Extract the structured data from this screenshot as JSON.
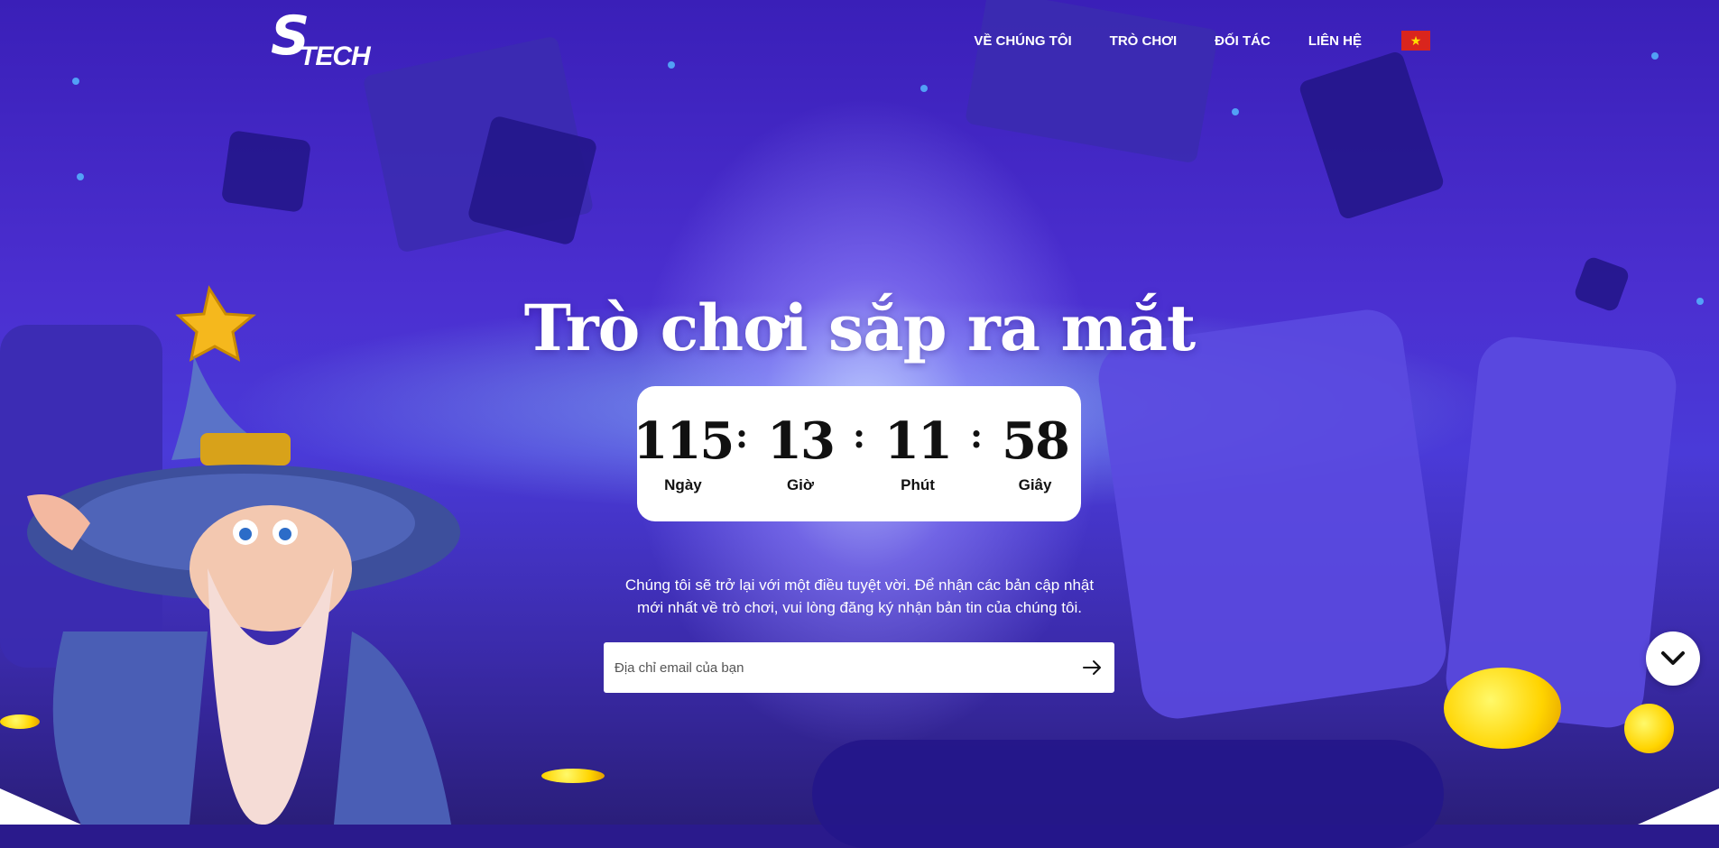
{
  "brand": {
    "logo_mark": "S",
    "logo_text": "TECH"
  },
  "nav": {
    "items": [
      {
        "label": "VỀ CHÚNG TÔI"
      },
      {
        "label": "TRÒ CHƠI"
      },
      {
        "label": "ĐỐI TÁC"
      },
      {
        "label": "LIÊN HỆ"
      }
    ],
    "language_icon": "vietnam-flag-icon"
  },
  "hero": {
    "title": "Trò chơi sắp ra mắt",
    "countdown": {
      "days": "115",
      "days_label": "Ngày",
      "hours": "13",
      "hours_label": "Giờ",
      "minutes": "11",
      "minutes_label": "Phút",
      "seconds": "58",
      "seconds_label": "Giây"
    },
    "description_line1": "Chúng tôi sẽ trở lại với một điều tuyệt vời. Để nhận các bản cập nhật",
    "description_line2": "mới nhất về trò chơi, vui lòng đăng ký nhận bản tin của chúng tôi.",
    "email_placeholder": "Địa chỉ email của bạn",
    "submit_icon": "arrow-right-icon"
  },
  "scroll_button_icon": "chevron-down-icon",
  "colors": {
    "background": "#4b2fd0",
    "card": "#ffffff",
    "text": "#111111",
    "flag_red": "#da251d",
    "flag_star": "#ffde00"
  }
}
